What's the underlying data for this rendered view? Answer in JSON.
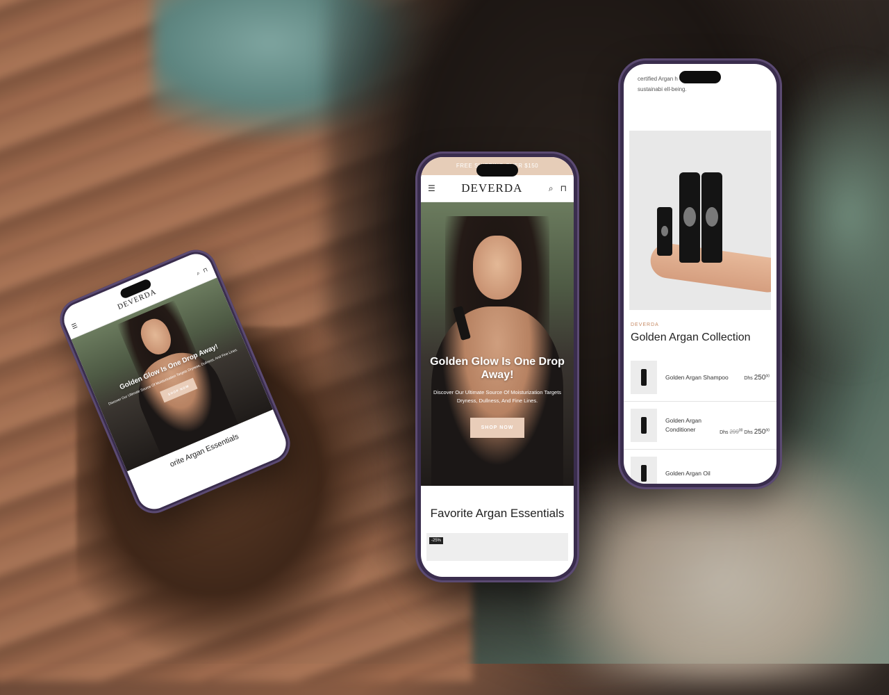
{
  "brand": {
    "logo": "DEVERDA",
    "tag": "DEVERDA"
  },
  "promo": {
    "text_center": "FREE SHIPPING          OVER $150"
  },
  "hero": {
    "title": "Golden Glow Is One Drop Away!",
    "subtitle": "Discover Our Ultimate Source Of Moisturization Targets Dryness, Dullness, And Fine Lines.",
    "cta": "SHOP NOW"
  },
  "sections": {
    "favorites_title": "Favorite Argan Essentials",
    "favorites_title_partial": "orite Argan Essentials",
    "badge": "-25%"
  },
  "about": {
    "line1": "certified Argan            h environmental",
    "line2": "sustainabi                 ell-being."
  },
  "collection": {
    "title": "Golden Argan Collection",
    "products": [
      {
        "name": "Golden Argan Shampoo",
        "currency": "Dhs",
        "price": "250",
        "cents": "00",
        "old_price": ""
      },
      {
        "name": "Golden Argan Conditioner",
        "currency": "Dhs",
        "price": "250",
        "cents": "00",
        "old_price": "299",
        "old_cents": "00"
      },
      {
        "name": "Golden Argan Oil",
        "currency": "",
        "price": "",
        "cents": "",
        "old_price": ""
      }
    ]
  },
  "icons": [
    "menu-icon",
    "search-icon",
    "bag-icon"
  ],
  "colors": {
    "accent": "#e6cdb8",
    "brand_tag": "#c68a63",
    "phone_frame": "#3a2d4d"
  }
}
